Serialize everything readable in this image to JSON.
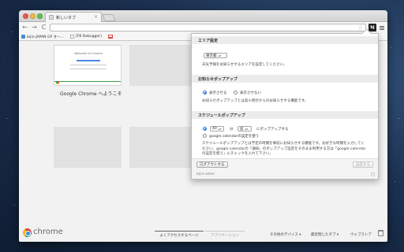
{
  "browser": {
    "tab_title": "新しいタブ",
    "tab_close": "×",
    "ext_label": "bj",
    "nav": {
      "back": "←",
      "forward": "→",
      "reload": "C"
    },
    "star": "☆"
  },
  "bookmarks": [
    {
      "label": "bijin-JAPAN GP オー...",
      "favicon_color": "#4a8ad4"
    },
    {
      "label": "[FB Debugger]",
      "favicon_color": "#ffffff"
    }
  ],
  "content": {
    "first_thumb_caption": "Google Chrome へようこそ",
    "welcome_title": "Welcome to Chrome"
  },
  "footer": {
    "brand": "chrome",
    "tab_most_visited": "よくアクセスするページ",
    "tab_apps": "アプリケーション",
    "other_devices": "その他のデバイス ▾",
    "recently_closed": "最近閉じたタブ ▾",
    "web_store": "ウェブストア"
  },
  "popup": {
    "area": {
      "title": "エリア設定",
      "selected": "東京都",
      "desc": "天気予報をお知らせするエリアを設定してください。"
    },
    "notify": {
      "title": "お知らせポップアップ",
      "opt_show": "表示させる",
      "opt_hide": "表示させない",
      "desc": "お知らせポップアップとは美人時計からのお知らせする機能です。"
    },
    "schedule": {
      "title": "スケジュールポップアップ",
      "minutes_value": "40",
      "unit_min": "分",
      "when_value": "前",
      "suffix": "にポップアップする",
      "google_cal": "google calendarの設定を使う",
      "desc": "スケジュールポップアップとは予定の時間を事前にお知らせする機能です。お好きな時間を入力してください。google calendarの「通知」のポップアップ設定をそのまま利用する方は「google calendarの設定を使う」にチェックを入れて下さい。"
    },
    "logout": "ログアウトする",
    "save": "設定する",
    "user": "bijin-seker"
  },
  "colors": {
    "accent": "#2b6fd8",
    "desktop": "#1d3354"
  }
}
